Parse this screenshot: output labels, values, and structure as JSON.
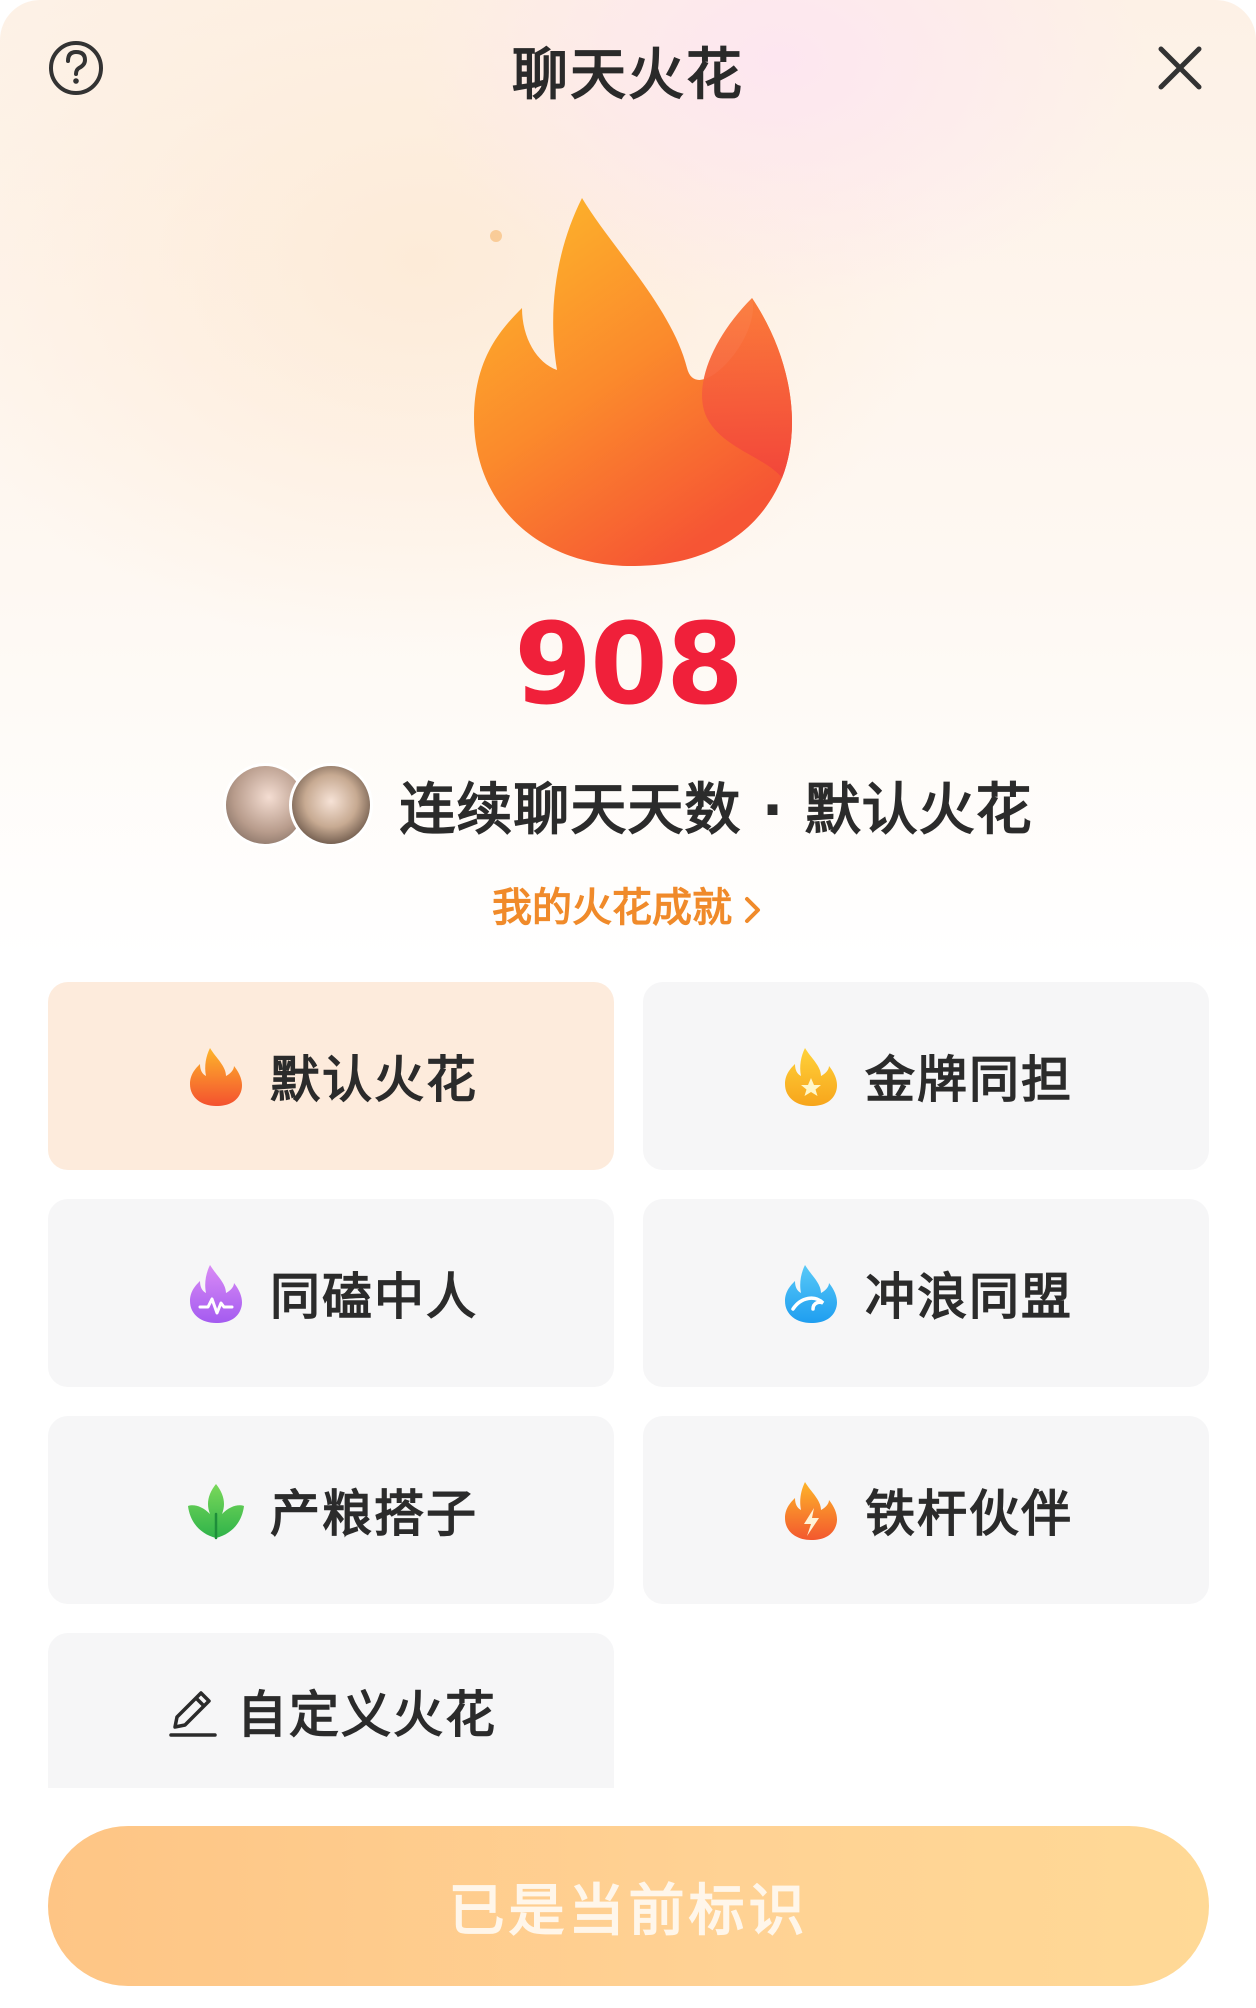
{
  "header": {
    "title": "聊天火花",
    "help_icon": "question-circle-icon",
    "close_icon": "close-icon"
  },
  "hero": {
    "icon": "flame-icon",
    "count": "908",
    "pair_text": "连续聊天天数 · 默认火花",
    "achievement_link": "我的火花成就"
  },
  "options": [
    {
      "label": "默认火花",
      "icon": "orange-flame-icon",
      "selected": true
    },
    {
      "label": "金牌同担",
      "icon": "gold-star-flame-icon",
      "selected": false
    },
    {
      "label": "同磕中人",
      "icon": "purple-flame-icon",
      "selected": false
    },
    {
      "label": "冲浪同盟",
      "icon": "blue-wave-flame-icon",
      "selected": false
    },
    {
      "label": "产粮搭子",
      "icon": "green-leaf-icon",
      "selected": false
    },
    {
      "label": "铁杆伙伴",
      "icon": "lightning-flame-icon",
      "selected": false
    },
    {
      "label": "自定义火花",
      "icon": "pencil-icon",
      "selected": false
    }
  ],
  "action_button": {
    "label": "已是当前标识"
  },
  "colors": {
    "count": "#f0203a",
    "achievement_link": "#f08a2a",
    "selected_card": "#fdebdc",
    "card": "#f6f6f7",
    "button": "#fec585"
  }
}
